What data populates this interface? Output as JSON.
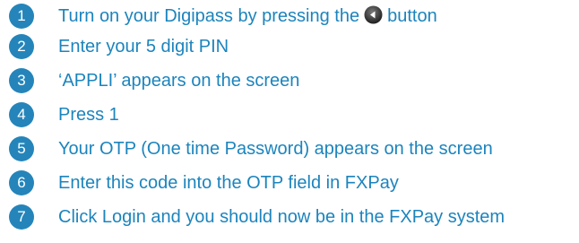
{
  "colors": {
    "badge": "#2585ba",
    "text": "#1c84bd"
  },
  "steps": [
    {
      "number": "1",
      "text_before": "Turn on your Digipass by pressing the",
      "icon": "power-button-icon",
      "text_after": "button"
    },
    {
      "number": "2",
      "text": "Enter your 5 digit PIN"
    },
    {
      "number": "3",
      "text": "‘APPLI’ appears on the screen"
    },
    {
      "number": "4",
      "text": "Press 1"
    },
    {
      "number": "5",
      "text": "Your OTP (One time Password) appears on the screen"
    },
    {
      "number": "6",
      "text": "Enter this code into the OTP field in FXPay"
    },
    {
      "number": "7",
      "text": "Click Login and you should now be in the FXPay system"
    }
  ]
}
